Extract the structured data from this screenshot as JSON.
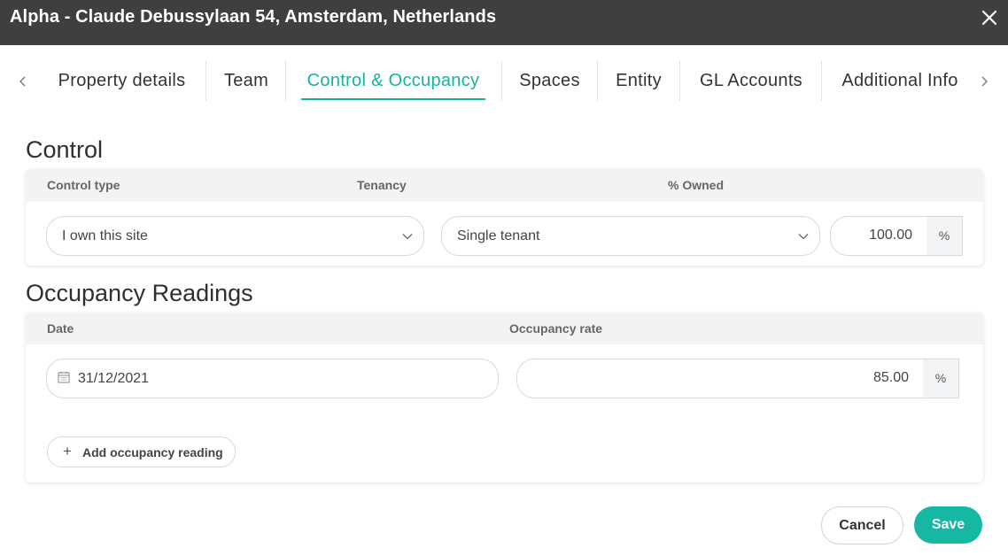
{
  "window": {
    "title": "Alpha - Claude Debussylaan 54, Amsterdam, Netherlands",
    "close_icon": "close-icon"
  },
  "tabs": {
    "prev_icon": "chevron-left-icon",
    "next_icon": "chevron-right-icon",
    "items": [
      {
        "label": "Property details"
      },
      {
        "label": "Team"
      },
      {
        "label": "Control & Occupancy",
        "active": true
      },
      {
        "label": "Spaces"
      },
      {
        "label": "Entity"
      },
      {
        "label": "GL Accounts"
      },
      {
        "label": "Additional Info"
      }
    ],
    "accent_color": "#14b3a0"
  },
  "control": {
    "title": "Control",
    "columns": [
      "Control type",
      "Tenancy",
      "% Owned"
    ],
    "control_type": "I own this site",
    "tenancy": "Single tenant",
    "owned_value": "100.00",
    "owned_unit": "%"
  },
  "occupancy": {
    "title": "Occupancy Readings",
    "columns": [
      "Date",
      "Occupancy rate"
    ],
    "readings": [
      {
        "date": "31/12/2021",
        "rate": "85.00",
        "unit": "%"
      }
    ],
    "calendar_icon": "calendar-icon",
    "add_label": "Add occupancy reading"
  },
  "footer": {
    "cancel_label": "Cancel",
    "save_label": "Save",
    "save_color": "#16b8a3"
  }
}
